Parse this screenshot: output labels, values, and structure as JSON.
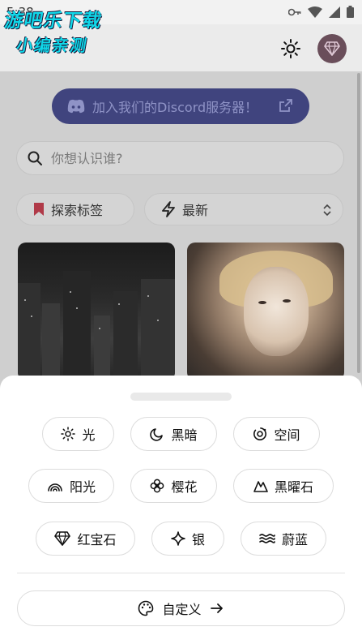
{
  "status_bar": {
    "time": "5:38"
  },
  "watermark": {
    "line1": "游吧乐下载",
    "line2": "小编亲测"
  },
  "discord_banner": {
    "label": "加入我们的Discord服务器！"
  },
  "search": {
    "placeholder": "你想认识谁?"
  },
  "filters": {
    "tags_label": "探索标签",
    "sort_label": "最新"
  },
  "theme_sheet": {
    "themes": [
      {
        "label": "光",
        "icon": "sun-icon"
      },
      {
        "label": "黑暗",
        "icon": "moon-icon"
      },
      {
        "label": "空间",
        "icon": "orbit-icon"
      },
      {
        "label": "阳光",
        "icon": "rainbow-icon"
      },
      {
        "label": "樱花",
        "icon": "flower-icon"
      },
      {
        "label": "黑曜石",
        "icon": "mountain-icon"
      },
      {
        "label": "红宝石",
        "icon": "gem-icon"
      },
      {
        "label": "银",
        "icon": "sparkle-icon"
      },
      {
        "label": "蔚蓝",
        "icon": "waves-icon"
      }
    ],
    "custom_label": "自定义"
  },
  "colors": {
    "accent_discord": "#5865F2",
    "sheet_background": "#ffffff",
    "premium_badge": "#7b1fa2"
  }
}
